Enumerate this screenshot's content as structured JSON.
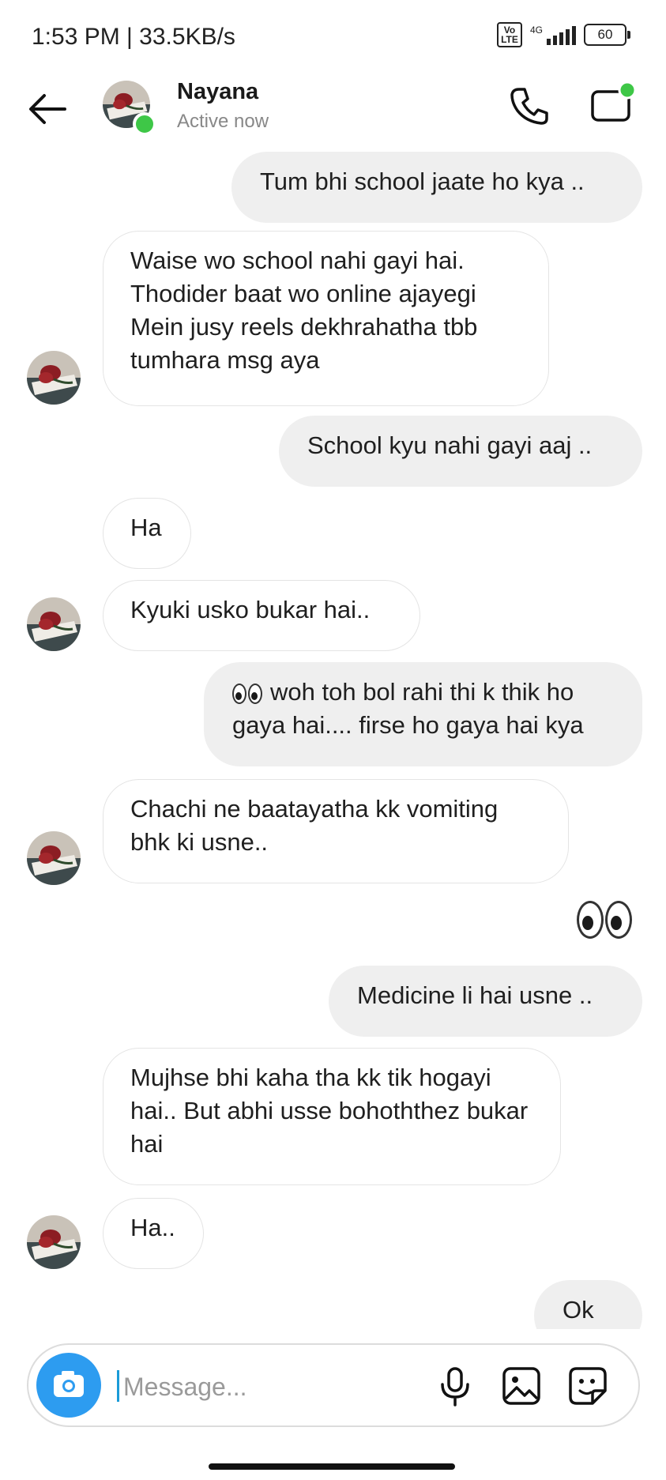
{
  "status_bar": {
    "time": "1:53 PM | 33.5KB/s",
    "volte": "Vo LTE",
    "network": "4G",
    "battery": "60"
  },
  "header": {
    "name": "Nayana",
    "status": "Active now",
    "online_color": "#3ec747",
    "icons": [
      "back-arrow-icon",
      "phone-icon",
      "video-camera-icon"
    ]
  },
  "messages": [
    {
      "side": "out",
      "text": "Tum bhi school jaate ho kya .."
    },
    {
      "side": "in",
      "text": "Waise wo school nahi gayi hai. Thodider baat wo online ajayegi Mein jusy reels dekhrahatha tbb tumhara msg aya",
      "avatar": true
    },
    {
      "side": "out",
      "text": "School kyu nahi gayi aaj .."
    },
    {
      "side": "in",
      "text": "Ha",
      "avatar": false
    },
    {
      "side": "in",
      "text": "Kyuki usko bukar hai..",
      "avatar": true
    },
    {
      "side": "out",
      "text": "woh toh bol rahi thi k thik ho gaya hai.... firse ho gaya hai kya",
      "emoji_prefix": "eyes"
    },
    {
      "side": "in",
      "text": "Chachi ne baatayatha kk vomiting bhk ki usne..",
      "avatar": true
    },
    {
      "side": "out",
      "emoji_only": "eyes"
    },
    {
      "side": "out",
      "text": "Medicine li hai usne .."
    },
    {
      "side": "in",
      "text": "Mujhse bhi kaha tha kk tik hogayi hai.. But abhi usse bohoththez bukar hai",
      "avatar": false
    },
    {
      "side": "in",
      "text": "Ha..",
      "avatar": true
    },
    {
      "side": "out",
      "text": "Ok .."
    }
  ],
  "composer": {
    "placeholder": "Message...",
    "camera_color": "#2d9cf0",
    "icons": [
      "camera-icon",
      "microphone-icon",
      "gallery-icon",
      "sticker-icon"
    ]
  }
}
